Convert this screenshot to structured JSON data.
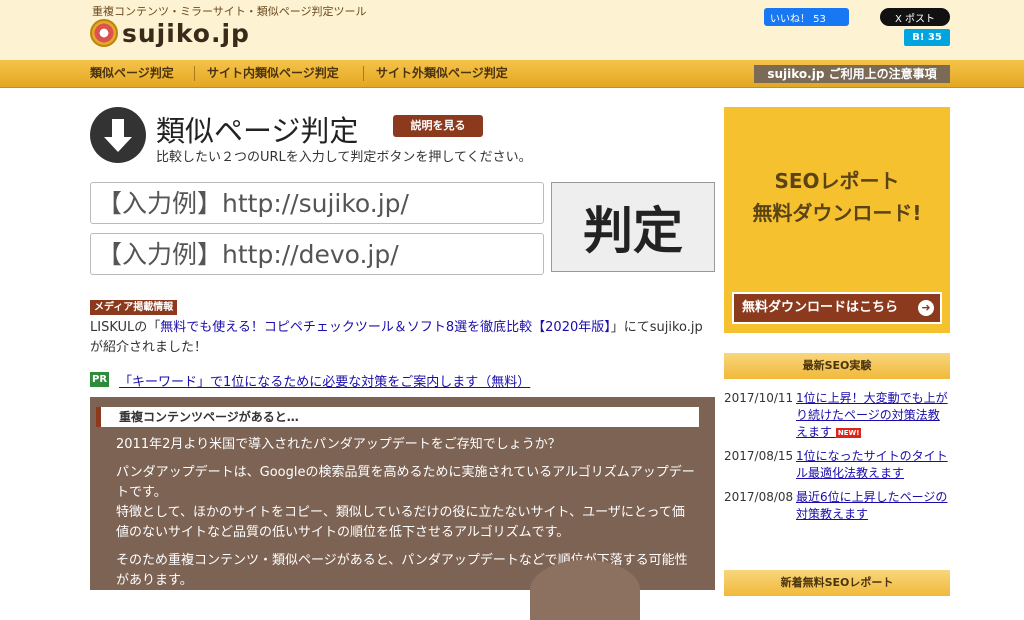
{
  "header": {
    "tagline": "重複コンテンツ・ミラーサイト・類似ページ判定ツール",
    "logo_text": "sujiko.jp",
    "facebook_label": "いいね！ 53",
    "x_label": "X ポスト",
    "hatena_label": "B! 35"
  },
  "nav": {
    "items": [
      "類似ページ判定",
      "サイト内類似ページ判定",
      "サイト外類似ページ判定"
    ],
    "notice_label": "sujiko.jp ご利用上の注意事項"
  },
  "main": {
    "title": "類似ページ判定",
    "explain_label": "説明を見る",
    "instruction": "比較したい２つのURLを入力して判定ボタンを押してください。",
    "url1_placeholder": "【入力例】http://sujiko.jp/",
    "url2_placeholder": "【入力例】http://devo.jp/",
    "judge_label": "判定"
  },
  "media": {
    "badge": "メディア掲載情報",
    "prefix": "LISKULの「",
    "link_text": "無料でも使える！コピペチェックツール＆ソフト8選を徹底比較【2020年版】",
    "suffix": "」にてsujiko.jpが紹介されました！"
  },
  "pr": {
    "badge": "PR",
    "link_text": "「キーワード」で1位になるために必要な対策をご案内します（無料）"
  },
  "info": {
    "heading": "重複コンテンツページがあると…",
    "p1": "2011年2月より米国で導入されたパンダアップデートをご存知でしょうか？",
    "p2": "パンダアップデートは、Googleの検索品質を高めるために実施されているアルゴリズムアップデートです。",
    "p3": "特徴として、ほかのサイトをコピー、類似しているだけの役に立たないサイト、ユーザにとって価値のないサイトなど品質の低いサイトの順位を低下させるアルゴリズムです。",
    "p4": "そのため重複コンテンツ・類似ページがあると、パンダアップデートなどで順位が下落する可能性があります。"
  },
  "sidebar": {
    "ad_line1": "SEOレポート",
    "ad_line2": "無料ダウンロード!",
    "ad_button": "無料ダウンロードはこちら",
    "seo_header": "最新SEO実験",
    "seo_items": [
      {
        "date": "2017/10/11",
        "title": "1位に上昇！大変動でも上がり続けたページの対策法教えます",
        "new": "NEW!"
      },
      {
        "date": "2017/08/15",
        "title": "1位になったサイトのタイトル最適化法教えます"
      },
      {
        "date": "2017/08/08",
        "title": "最近6位に上昇したページの対策教えます"
      }
    ],
    "report_header": "新着無料SEOレポート"
  }
}
